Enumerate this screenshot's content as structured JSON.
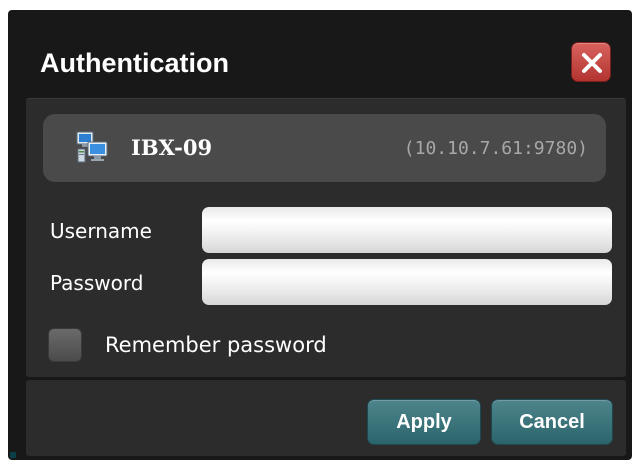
{
  "dialog": {
    "title": "Authentication",
    "close_icon": "close-x-icon"
  },
  "server": {
    "icon": "network-computers-icon",
    "name": "IBX-09",
    "address": "(10.10.7.61:9780)"
  },
  "form": {
    "username_label": "Username",
    "username_value": "",
    "password_label": "Password",
    "password_value": "",
    "remember_label": "Remember password",
    "remember_checked": false
  },
  "footer": {
    "apply_label": "Apply",
    "cancel_label": "Cancel"
  },
  "colors": {
    "dialog_bg": "#181818",
    "panel_bg": "#2c2c2c",
    "server_box_bg": "#4a4a4a",
    "close_button": "#c9453f",
    "action_button": "#3c7178"
  }
}
